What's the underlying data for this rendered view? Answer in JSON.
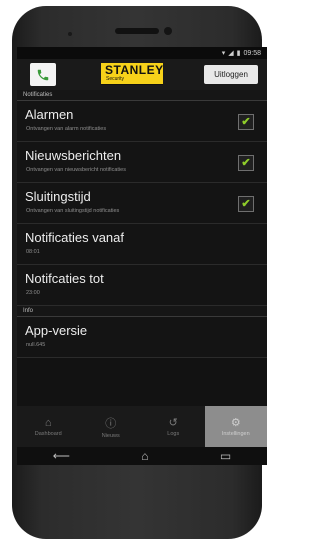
{
  "status": {
    "time": "09:58"
  },
  "header": {
    "logo_text": "STANLEY",
    "logo_sub": "Security",
    "logout_label": "Uitloggen"
  },
  "sections": [
    {
      "label": "Notificaties"
    },
    {
      "label": "Info"
    }
  ],
  "rows": [
    {
      "title": "Alarmen",
      "subtitle": "Ontvangen van alarm notificaties",
      "checked": true
    },
    {
      "title": "Nieuwsberichten",
      "subtitle": "Ontvangen van nieuwsbericht notificaties",
      "checked": true
    },
    {
      "title": "Sluitingstijd",
      "subtitle": "Ontvangen van sluitingstijd notificaties",
      "checked": true
    },
    {
      "title": "Notificaties vanaf",
      "subtitle": "08:01"
    },
    {
      "title": "Notifcaties tot",
      "subtitle": "23:00"
    },
    {
      "title": "App-versie",
      "subtitle": "null.645"
    }
  ],
  "nav": [
    {
      "label": "Dashboard",
      "icon": "home-icon"
    },
    {
      "label": "Nieuws",
      "icon": "info-icon"
    },
    {
      "label": "Logs",
      "icon": "history-icon"
    },
    {
      "label": "Instellingen",
      "icon": "settings-icon"
    }
  ],
  "colors": {
    "accent": "#f7d21a",
    "check": "#8fcd2a",
    "active_tab": "#8d8d8d"
  }
}
